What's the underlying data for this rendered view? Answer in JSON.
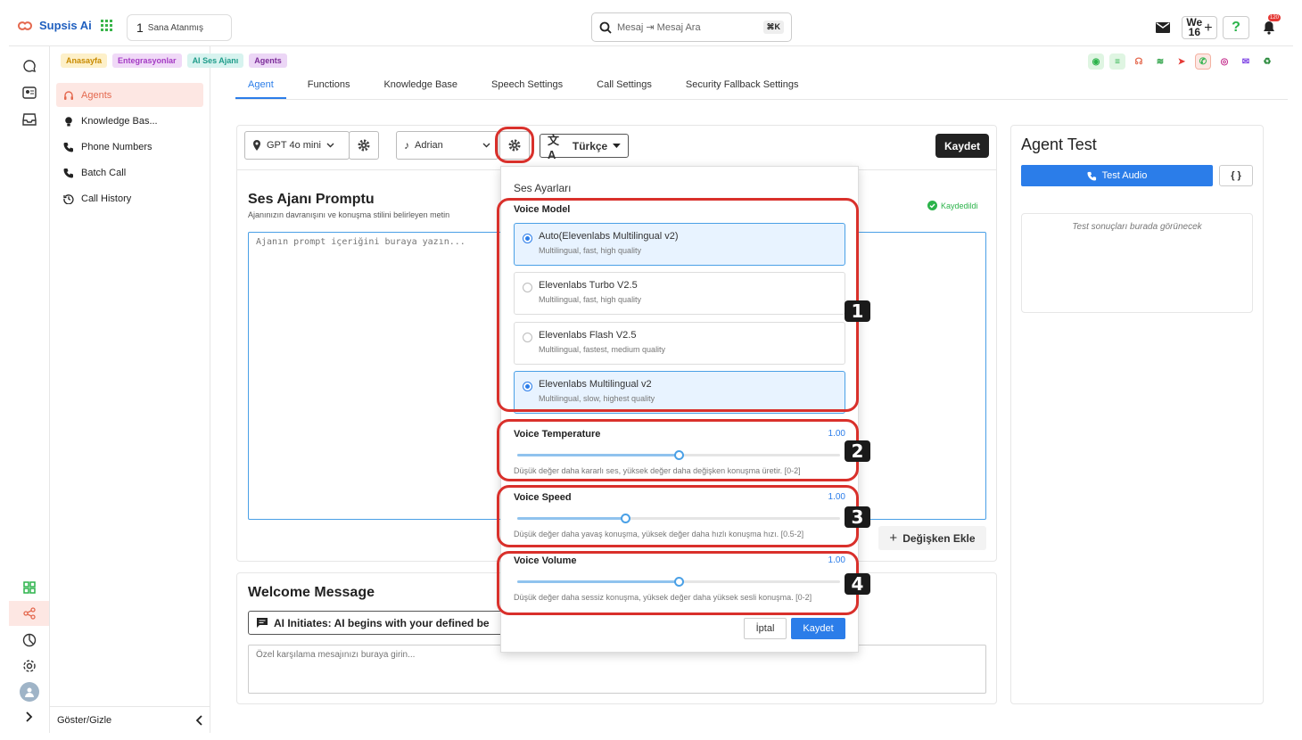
{
  "topbar": {
    "logo": "Supsis Ai",
    "assigned_count": "1",
    "assigned_label": "Sana Atanmış",
    "search_placeholder": "Mesaj ⇥ Mesaj Ara",
    "search_shortcut": "⌘K",
    "we_label": "We",
    "we_count": "16",
    "help_label": "?",
    "notif_count": "120"
  },
  "tags": [
    "Anasayfa",
    "Entegrasyonlar",
    "AI Ses Ajanı",
    "Agents"
  ],
  "sidebar": {
    "items": [
      {
        "label": "Agents",
        "icon": "headset-icon"
      },
      {
        "label": "Knowledge Bas...",
        "icon": "bulb-icon"
      },
      {
        "label": "Phone Numbers",
        "icon": "phone-icon"
      },
      {
        "label": "Batch Call",
        "icon": "phone-icon"
      },
      {
        "label": "Call History",
        "icon": "history-icon"
      }
    ],
    "footer_label": "Göster/Gizle"
  },
  "tabs": [
    "Agent",
    "Functions",
    "Knowledge Base",
    "Speech Settings",
    "Call Settings",
    "Security Fallback Settings"
  ],
  "toolbar": {
    "model": "GPT 4o mini",
    "voice": "Adrian",
    "language": "Türkçe",
    "save_label": "Kaydet"
  },
  "prompt": {
    "title": "Ses Ajanı Promptu",
    "subtitle": "Ajanınızın davranışını ve konuşma stilini belirleyen metin",
    "saved_label": "Kaydedildi",
    "placeholder": "Ajanın prompt içeriğini buraya yazın...",
    "add_variable_label": "Değişken Ekle"
  },
  "welcome": {
    "title": "Welcome Message",
    "initiator_label": "AI Initiates: AI begins with your defined be",
    "placeholder": "Özel karşılama mesajınızı buraya girin..."
  },
  "agent_test": {
    "title": "Agent Test",
    "test_audio_label": "Test Audio",
    "results_placeholder": "Test sonuçları burada görünecek"
  },
  "voice_settings": {
    "title": "Ses Ayarları",
    "model_label": "Voice Model",
    "options": [
      {
        "name": "Auto(Elevenlabs Multilingual v2)",
        "desc": "Multilingual, fast, high quality",
        "selected": true
      },
      {
        "name": "Elevenlabs Turbo V2.5",
        "desc": "Multilingual, fast, high quality",
        "selected": false
      },
      {
        "name": "Elevenlabs Flash V2.5",
        "desc": "Multilingual, fastest, medium quality",
        "selected": false
      },
      {
        "name": "Elevenlabs Multilingual v2",
        "desc": "Multilingual, slow, highest quality",
        "selected": true
      }
    ],
    "sliders": [
      {
        "label": "Voice Temperature",
        "value_text": "1.00",
        "value": 1.0,
        "min": 0,
        "max": 2,
        "help": "Düşük değer daha kararlı ses, yüksek değer daha değişken konuşma üretir. [0-2]"
      },
      {
        "label": "Voice Speed",
        "value_text": "1.00",
        "value": 1.0,
        "min": 0.5,
        "max": 2,
        "help": "Düşük değer daha yavaş konuşma, yüksek değer daha hızlı konuşma hızı. [0.5-2]"
      },
      {
        "label": "Voice Volume",
        "value_text": "1.00",
        "value": 1.0,
        "min": 0,
        "max": 2,
        "help": "Düşük değer daha sessiz konuşma, yüksek değer daha yüksek sesli konuşma. [0-2]"
      }
    ],
    "cancel_label": "İptal",
    "save_label": "Kaydet"
  },
  "annotations": [
    "1",
    "2",
    "3",
    "4"
  ],
  "colors": {
    "accent": "#2b7de9",
    "annotation": "#d9302b",
    "active_bg": "#fde7e3",
    "active_text": "#e4694f"
  }
}
